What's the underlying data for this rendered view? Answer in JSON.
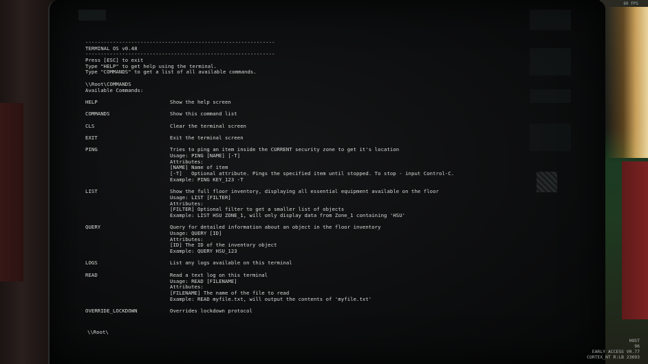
{
  "hud_top_right": "60 FPS",
  "terminal": {
    "divider": "--------------------------------------------------------------------------------",
    "title": "TERMINAL OS v0.48",
    "intro": [
      "Press [ESC] to exit",
      "Type \"HELP\" to get help using the terminal.",
      "Type \"COMMANDS\" to get a list of all available commands."
    ],
    "path": "\\\\Root\\COMMANDS",
    "available": "Available Commands:",
    "commands": [
      {
        "name": "HELP",
        "lines": [
          "Show the help screen"
        ]
      },
      {
        "name": "COMMANDS",
        "lines": [
          "Show this command list"
        ]
      },
      {
        "name": "CLS",
        "lines": [
          "Clear the terminal screen"
        ]
      },
      {
        "name": "EXIT",
        "lines": [
          "Exit the terminal screen"
        ]
      },
      {
        "name": "PING",
        "lines": [
          "Tries to ping an item inside the CURRENT security zone to get it's location",
          "Usage: PING [NAME] [-T]",
          "Attributes:",
          "[NAME] Name of item",
          "[-T]   Optional attribute. Pings the specified item until stopped. To stop - input Control-C.",
          "Example: PING KEY_123 -T"
        ]
      },
      {
        "name": "LIST",
        "lines": [
          "Show the full floor inventory, displaying all essential equipment available on the floor",
          "Usage: LIST [FILTER]",
          "Attributes:",
          "[FILTER] Optional filter to get a smaller list of objects",
          "Example: LIST HSU ZONE_1, will only display data from Zone_1 containing 'HSU'"
        ]
      },
      {
        "name": "QUERY",
        "lines": [
          "Query for detailed information about an object in the floor inventory",
          "Usage: QUERY [ID]",
          "Attributes:",
          "[ID] The ID of the inventory object",
          "Example: QUERY HSU_123"
        ]
      },
      {
        "name": "LOGS",
        "lines": [
          "List any logs available on this terminal"
        ]
      },
      {
        "name": "READ",
        "lines": [
          "Read a text log on this terminal",
          "Usage: READ [FILENAME]",
          "Attributes:",
          "[FILENAME] The name of the file to read",
          "Example: READ myfile.txt, will output the contents of 'myfile.txt'"
        ]
      },
      {
        "name": "OVERRIDE_LOCKDOWN",
        "lines": [
          "Overrides lockdown protocol"
        ]
      }
    ],
    "prompt": "\\\\Root\\"
  },
  "hud": {
    "label": "HOST",
    "value": "96",
    "build": "EARLY ACCESS V0.77",
    "machine": "CORTEX_NT R:LB 23693"
  }
}
